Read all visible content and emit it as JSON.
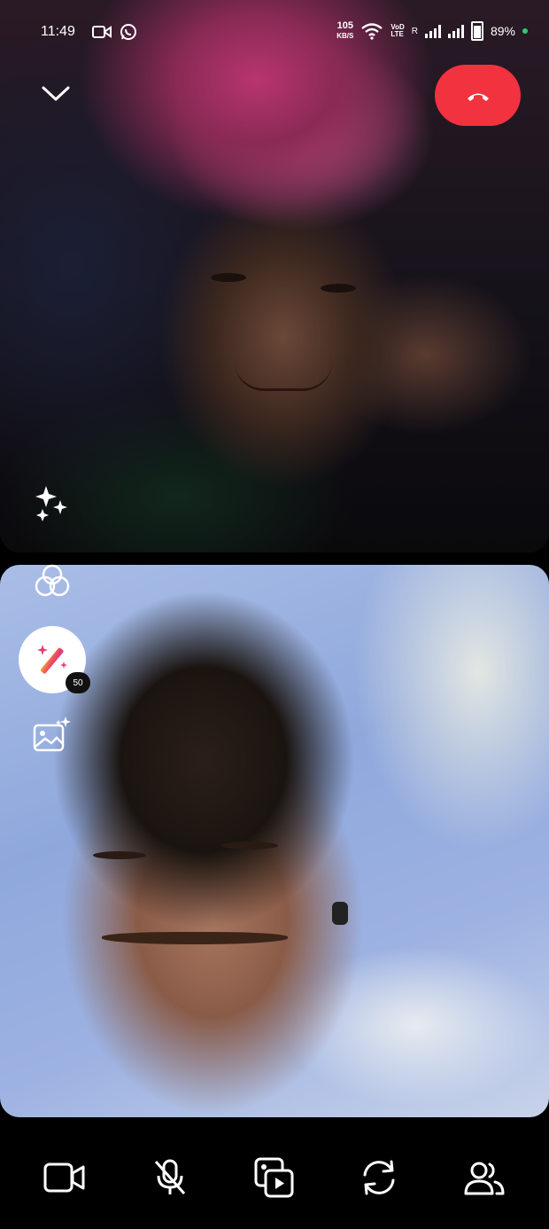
{
  "status_bar": {
    "time": "11:49",
    "net_speed_value": "105",
    "net_speed_unit": "KB/S",
    "volte_label_top": "VoD",
    "volte_label_bottom": "LTE",
    "roaming": "R",
    "battery": "89%",
    "notification_icons": [
      "video-camera-icon",
      "whatsapp-icon"
    ]
  },
  "call": {
    "end_call_color": "#f2323f",
    "effects_count_badge": "50"
  },
  "controls": [
    {
      "name": "camera",
      "icon": "video-camera-icon"
    },
    {
      "name": "mute",
      "icon": "microphone-muted-icon"
    },
    {
      "name": "share-media",
      "icon": "gallery-play-icon"
    },
    {
      "name": "flip-camera",
      "icon": "camera-switch-icon"
    },
    {
      "name": "participants",
      "icon": "people-icon"
    }
  ]
}
